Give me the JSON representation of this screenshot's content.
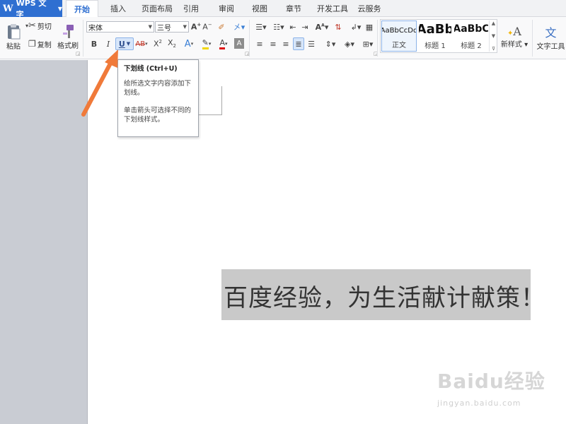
{
  "app": {
    "name": "WPS 文字"
  },
  "tabs": [
    {
      "label": "开始",
      "active": true
    },
    {
      "label": "插入"
    },
    {
      "label": "页面布局"
    },
    {
      "label": "引用"
    },
    {
      "label": "审阅"
    },
    {
      "label": "视图"
    },
    {
      "label": "章节"
    },
    {
      "label": "开发工具"
    },
    {
      "label": "云服务"
    }
  ],
  "clipboard": {
    "paste": "粘贴",
    "cut": "剪切",
    "copy": "复制",
    "format_painter": "格式刷"
  },
  "font": {
    "name": "宋体",
    "size": "三号"
  },
  "styles": {
    "items": [
      {
        "sample": "AaBbCcDd",
        "name": "正文",
        "selected": true
      },
      {
        "sample": "AaBb",
        "name": "标题 1"
      },
      {
        "sample": "AaBbC",
        "name": "标题 2"
      }
    ],
    "new_style": "新样式",
    "text_tools": "文字工具"
  },
  "tooltip": {
    "title": "下划线 (Ctrl+U)",
    "line1": "给所选文字内容添加下划线。",
    "line2": "单击箭头可选择不同的下划线样式。"
  },
  "document": {
    "text": "百度经验，为生活献计献策！"
  },
  "watermark": {
    "logo": "Baidu经验",
    "url": "jingyan.baidu.com"
  },
  "colors": {
    "accent": "#2f6fd1",
    "arrow": "#f07a3a",
    "highlight": "#c9c9c9"
  }
}
